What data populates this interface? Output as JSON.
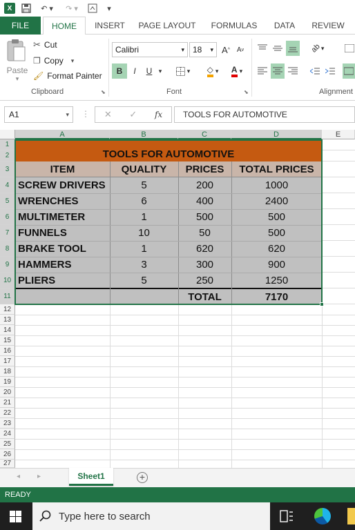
{
  "qat": {
    "logo": "X"
  },
  "tabs": [
    "FILE",
    "HOME",
    "INSERT",
    "PAGE LAYOUT",
    "FORMULAS",
    "DATA",
    "REVIEW"
  ],
  "clipboard": {
    "paste": "Paste",
    "cut": "Cut",
    "copy": "Copy",
    "format_painter": "Format Painter",
    "group": "Clipboard"
  },
  "font": {
    "name": "Calibri",
    "size": "18",
    "group": "Font",
    "bold": "B",
    "italic": "I",
    "underline": "U"
  },
  "alignment": {
    "group": "Alignment"
  },
  "formula_bar": {
    "name_box": "A1",
    "fx": "fx",
    "content": "TOOLS FOR AUTOMOTIVE",
    "cancel": "✕",
    "enter": "✓"
  },
  "columns": [
    "A",
    "B",
    "C",
    "D",
    "E"
  ],
  "rows": [
    "1",
    "2",
    "3",
    "4",
    "5",
    "6",
    "7",
    "8",
    "9",
    "10",
    "11",
    "12",
    "13",
    "14",
    "15",
    "16",
    "17",
    "18",
    "19",
    "20",
    "21",
    "22",
    "23",
    "24",
    "25",
    "26",
    "27"
  ],
  "table": {
    "title": "TOOLS FOR AUTOMOTIVE",
    "headers": [
      "ITEM",
      "QUALITY",
      "PRICES",
      "TOTAL PRICES"
    ],
    "rows": [
      [
        "SCREW DRIVERS",
        "5",
        "200",
        "1000"
      ],
      [
        "WRENCHES",
        "6",
        "400",
        "2400"
      ],
      [
        "MULTIMETER",
        "1",
        "500",
        "500"
      ],
      [
        "FUNNELS",
        "10",
        "50",
        "500"
      ],
      [
        "BRAKE TOOL",
        "1",
        "620",
        "620"
      ],
      [
        "HAMMERS",
        "3",
        "300",
        "900"
      ],
      [
        "PLIERS",
        "5",
        "250",
        "1250"
      ]
    ],
    "total_label": "TOTAL",
    "total_value": "7170"
  },
  "sheet": {
    "tab": "Sheet1",
    "add": "+"
  },
  "status": "READY",
  "taskbar": {
    "search": "Type here to search"
  },
  "colors": {
    "accent": "#217346",
    "title_fill": "#c55a11",
    "header_fill": "#c9b5a9",
    "body_fill": "#c0c0c0"
  }
}
